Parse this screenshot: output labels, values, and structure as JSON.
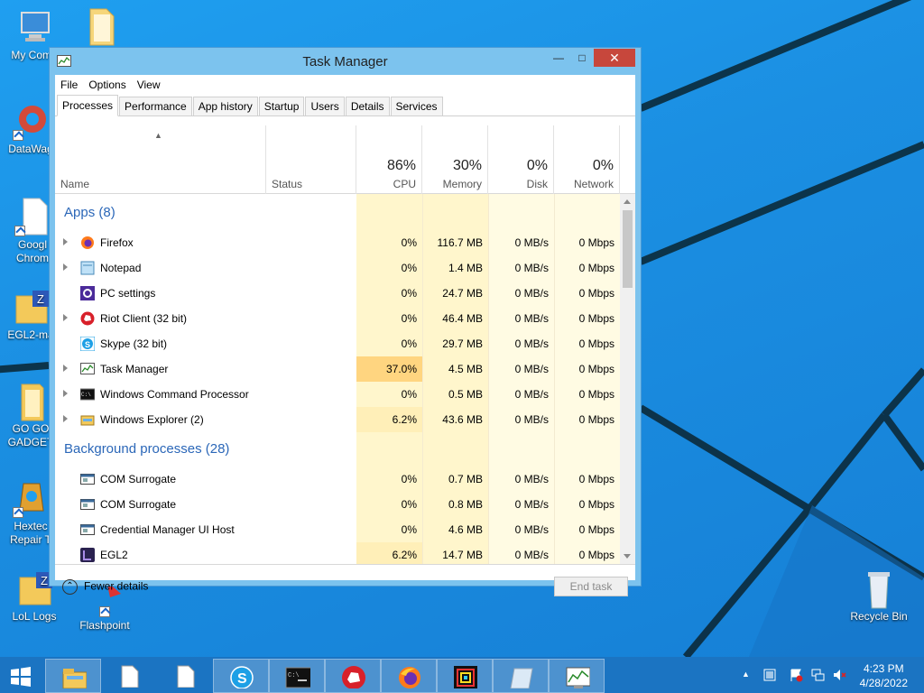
{
  "desktop": {
    "icons": [
      {
        "label": "My Comp",
        "name": "my-computer"
      },
      {
        "label": "",
        "name": "folder-top"
      },
      {
        "label": "DataWag",
        "name": "datawag"
      },
      {
        "label": "Googl\nChrom",
        "name": "google-chrome"
      },
      {
        "label": "EGL2-ma",
        "name": "egl2-folder"
      },
      {
        "label": "GO GO\nGADGET",
        "name": "go-go-gadget"
      },
      {
        "label": "Hextec\nRepair T",
        "name": "hextech-repair"
      },
      {
        "label": "LoL Logs",
        "name": "lol-logs"
      },
      {
        "label": "Flashpoint",
        "name": "flashpoint"
      },
      {
        "label": "Recycle Bin",
        "name": "recycle-bin"
      }
    ]
  },
  "window": {
    "title": "Task Manager",
    "minimize": "—",
    "maximize": "□",
    "close": "✕"
  },
  "menu": [
    "File",
    "Options",
    "View"
  ],
  "tabs": [
    "Processes",
    "Performance",
    "App history",
    "Startup",
    "Users",
    "Details",
    "Services"
  ],
  "header": {
    "name": "Name",
    "status": "Status",
    "cpu": {
      "pct": "86%",
      "label": "CPU"
    },
    "memory": {
      "pct": "30%",
      "label": "Memory"
    },
    "disk": {
      "pct": "0%",
      "label": "Disk"
    },
    "network": {
      "pct": "0%",
      "label": "Network"
    }
  },
  "groups": {
    "apps": "Apps (8)",
    "background": "Background processes (28)"
  },
  "apps": [
    {
      "name": "Firefox",
      "icon": "firefox-icon",
      "expand": true,
      "cpu": "0%",
      "mem": "116.7 MB",
      "disk": "0 MB/s",
      "net": "0 Mbps"
    },
    {
      "name": "Notepad",
      "icon": "notepad-icon",
      "expand": true,
      "cpu": "0%",
      "mem": "1.4 MB",
      "disk": "0 MB/s",
      "net": "0 Mbps"
    },
    {
      "name": "PC settings",
      "icon": "settings-icon",
      "expand": false,
      "cpu": "0%",
      "mem": "24.7 MB",
      "disk": "0 MB/s",
      "net": "0 Mbps"
    },
    {
      "name": "Riot Client (32 bit)",
      "icon": "riot-icon",
      "expand": true,
      "cpu": "0%",
      "mem": "46.4 MB",
      "disk": "0 MB/s",
      "net": "0 Mbps"
    },
    {
      "name": "Skype (32 bit)",
      "icon": "skype-icon",
      "expand": false,
      "cpu": "0%",
      "mem": "29.7 MB",
      "disk": "0 MB/s",
      "net": "0 Mbps"
    },
    {
      "name": "Task Manager",
      "icon": "task-manager-icon",
      "expand": true,
      "cpu": "37.0%",
      "mem": "4.5 MB",
      "disk": "0 MB/s",
      "net": "0 Mbps"
    },
    {
      "name": "Windows Command Processor",
      "icon": "cmd-icon",
      "expand": true,
      "cpu": "0%",
      "mem": "0.5 MB",
      "disk": "0 MB/s",
      "net": "0 Mbps"
    },
    {
      "name": "Windows Explorer (2)",
      "icon": "explorer-icon",
      "expand": true,
      "cpu": "6.2%",
      "mem": "43.6 MB",
      "disk": "0 MB/s",
      "net": "0 Mbps"
    }
  ],
  "background": [
    {
      "name": "COM Surrogate",
      "icon": "com-surrogate-icon",
      "cpu": "0%",
      "mem": "0.7 MB",
      "disk": "0 MB/s",
      "net": "0 Mbps"
    },
    {
      "name": "COM Surrogate",
      "icon": "com-surrogate-icon",
      "cpu": "0%",
      "mem": "0.8 MB",
      "disk": "0 MB/s",
      "net": "0 Mbps"
    },
    {
      "name": "Credential Manager UI Host",
      "icon": "credential-icon",
      "cpu": "0%",
      "mem": "4.6 MB",
      "disk": "0 MB/s",
      "net": "0 Mbps"
    },
    {
      "name": "EGL2",
      "icon": "egl2-icon",
      "cpu": "6.2%",
      "mem": "14.7 MB",
      "disk": "0 MB/s",
      "net": "0 Mbps"
    }
  ],
  "footer": {
    "fewer": "Fewer details",
    "end_task": "End task"
  },
  "taskbar": {
    "items": [
      "start",
      "file-explorer",
      "notepad-1",
      "notepad-2",
      "skype",
      "cmd",
      "riot-client",
      "firefox",
      "egl2",
      "notes-app",
      "task-manager"
    ],
    "clock_time": "4:23 PM",
    "clock_date": "4/28/2022"
  },
  "colors": {
    "heat_low": "#fff6cc",
    "heat_lighter": "#fffbe3",
    "heat_high": "#ffd580",
    "group": "#2b67b8"
  }
}
